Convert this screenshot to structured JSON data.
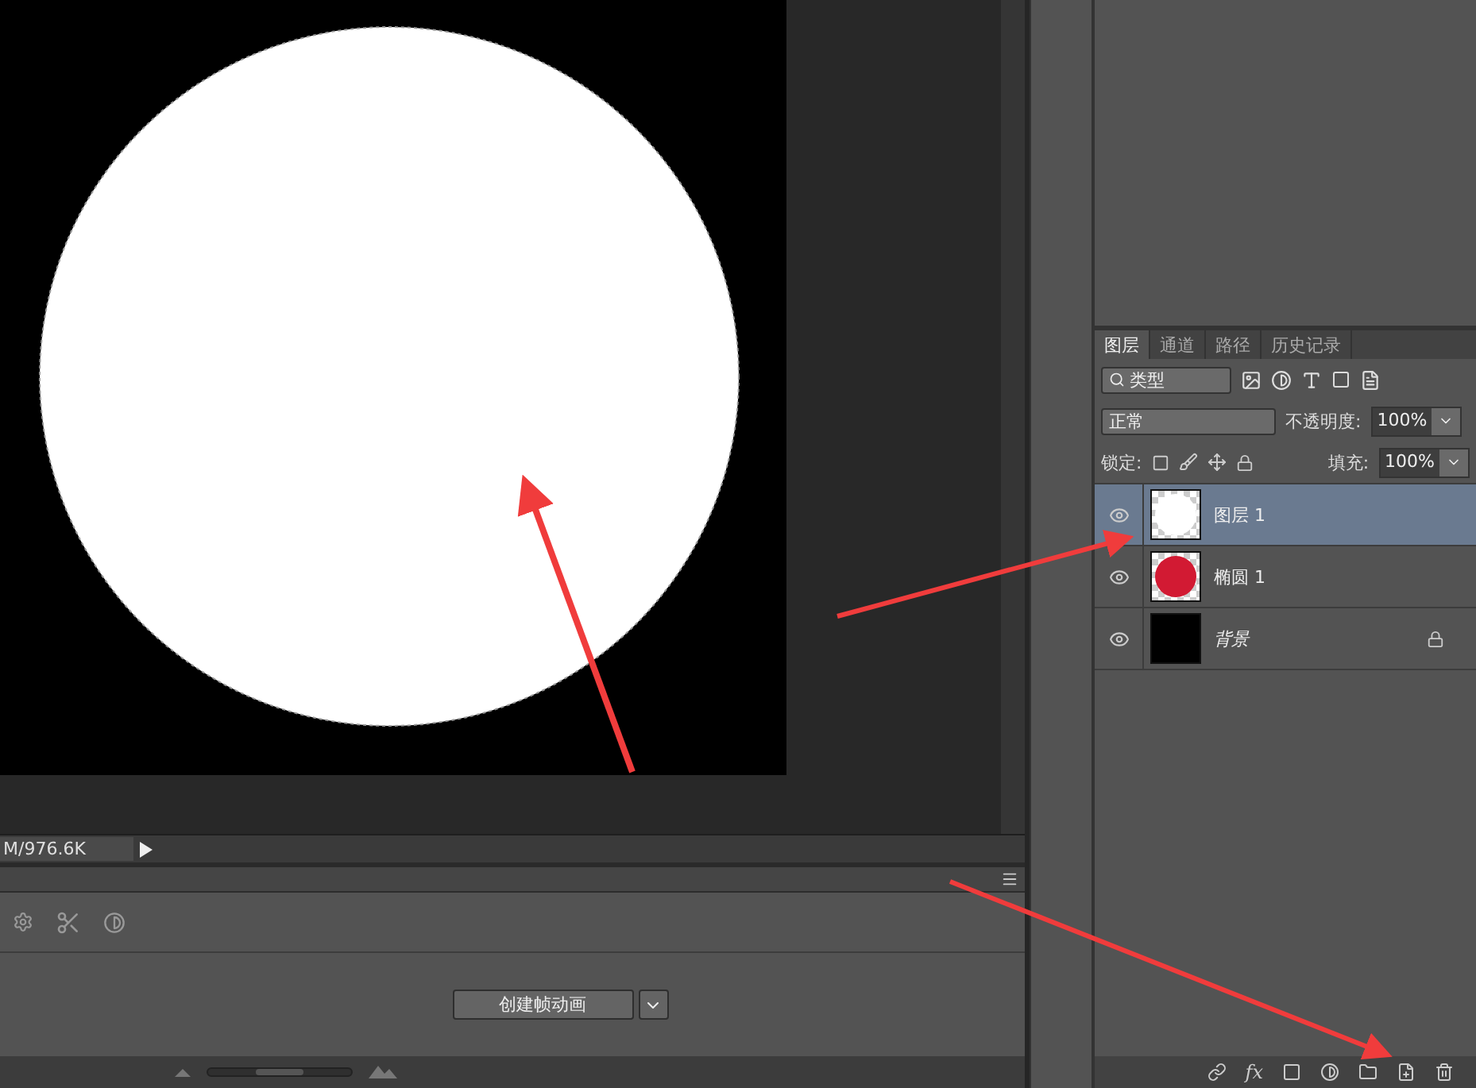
{
  "document": {
    "status_text": "M/976.6K"
  },
  "timeline": {
    "create_button": "创建帧动画",
    "zoom": {
      "level": 0.5
    }
  },
  "layers_panel": {
    "tabs": [
      {
        "label": "图层",
        "selected": true
      },
      {
        "label": "通道",
        "selected": false
      },
      {
        "label": "路径",
        "selected": false
      },
      {
        "label": "历史记录",
        "selected": false
      }
    ],
    "filter_label": "类型",
    "blend_mode": "正常",
    "opacity_label": "不透明度:",
    "opacity": "100%",
    "lock_label": "锁定:",
    "fill_label": "填充:",
    "fill": "100%",
    "fx_label": "fx",
    "layers": [
      {
        "name": "图层 1",
        "kind": "pixel",
        "selected": true,
        "visible": true,
        "locked": false
      },
      {
        "name": "椭圆 1",
        "kind": "shape",
        "selected": false,
        "visible": true,
        "locked": false
      },
      {
        "name": "背景",
        "kind": "background",
        "selected": false,
        "visible": true,
        "locked": true
      }
    ]
  }
}
